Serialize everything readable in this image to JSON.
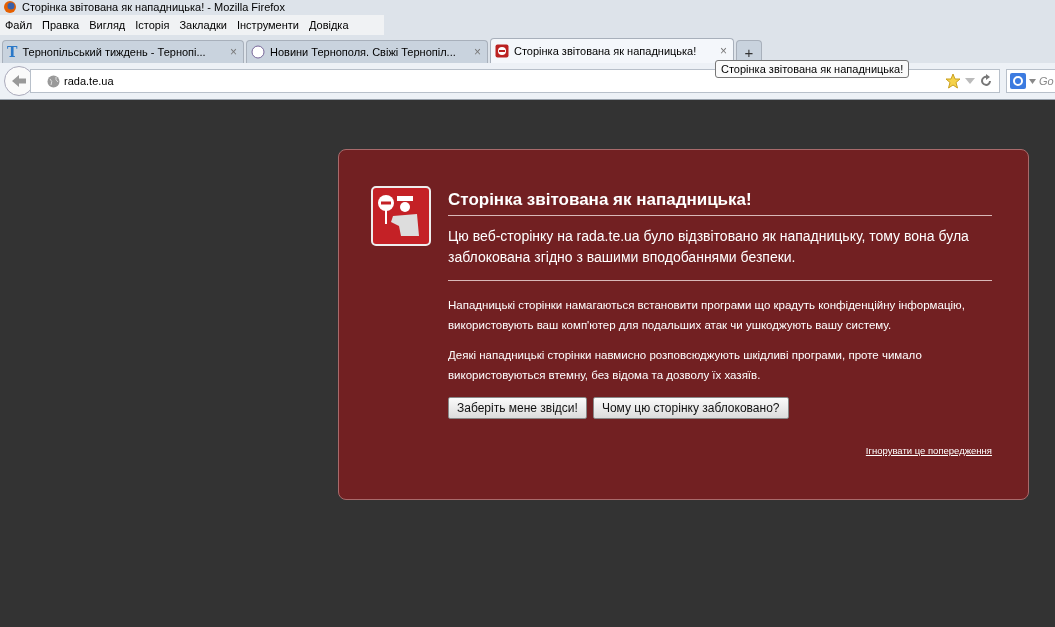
{
  "window": {
    "title": "Сторінка звітована як нападницька! - Mozilla Firefox"
  },
  "menu": [
    "Файл",
    "Правка",
    "Вигляд",
    "Історія",
    "Закладки",
    "Інструменти",
    "Довідка"
  ],
  "tabs": [
    {
      "label": "Тернопільський тиждень - Тернопі...",
      "selected": false,
      "kind": "letter",
      "icon_text": "T",
      "close": "×"
    },
    {
      "label": "Новини Тернополя. Свіжі Тернопіл...",
      "selected": false,
      "kind": "circle",
      "close": "×"
    },
    {
      "label": "Сторінка звітована як нападницька!",
      "selected": true,
      "kind": "blocked",
      "close": "×"
    }
  ],
  "new_tab": "+",
  "tooltip": "Сторінка звітована як нападницька!",
  "address": {
    "value": "rada.te.ua"
  },
  "search": {
    "placeholder": "Go"
  },
  "warning": {
    "title": "Сторінка звітована як нападницька!",
    "lead": "Цю веб-сторінку на rada.te.ua було відзвітовано як нападницьку, тому вона була заблокована згідно з вашими вподобаннями безпеки.",
    "paragraphs": [
      "Нападницькі сторінки намагаються встановити програми що крадуть конфіденційну інформацію, використовують ваш комп'ютер для подальших атак чи ушкоджують вашу систему.",
      "Деякі нападницькі сторінки навмисно розповсюджують шкідливі програми, проте чимало використовуються втемну, без відома та дозволу їх хазяїв."
    ],
    "buttons": [
      "Заберіть мене звідси!",
      "Чому цю сторінку заблоковано?"
    ],
    "ignore_link": "Ігнорувати це попередження"
  }
}
